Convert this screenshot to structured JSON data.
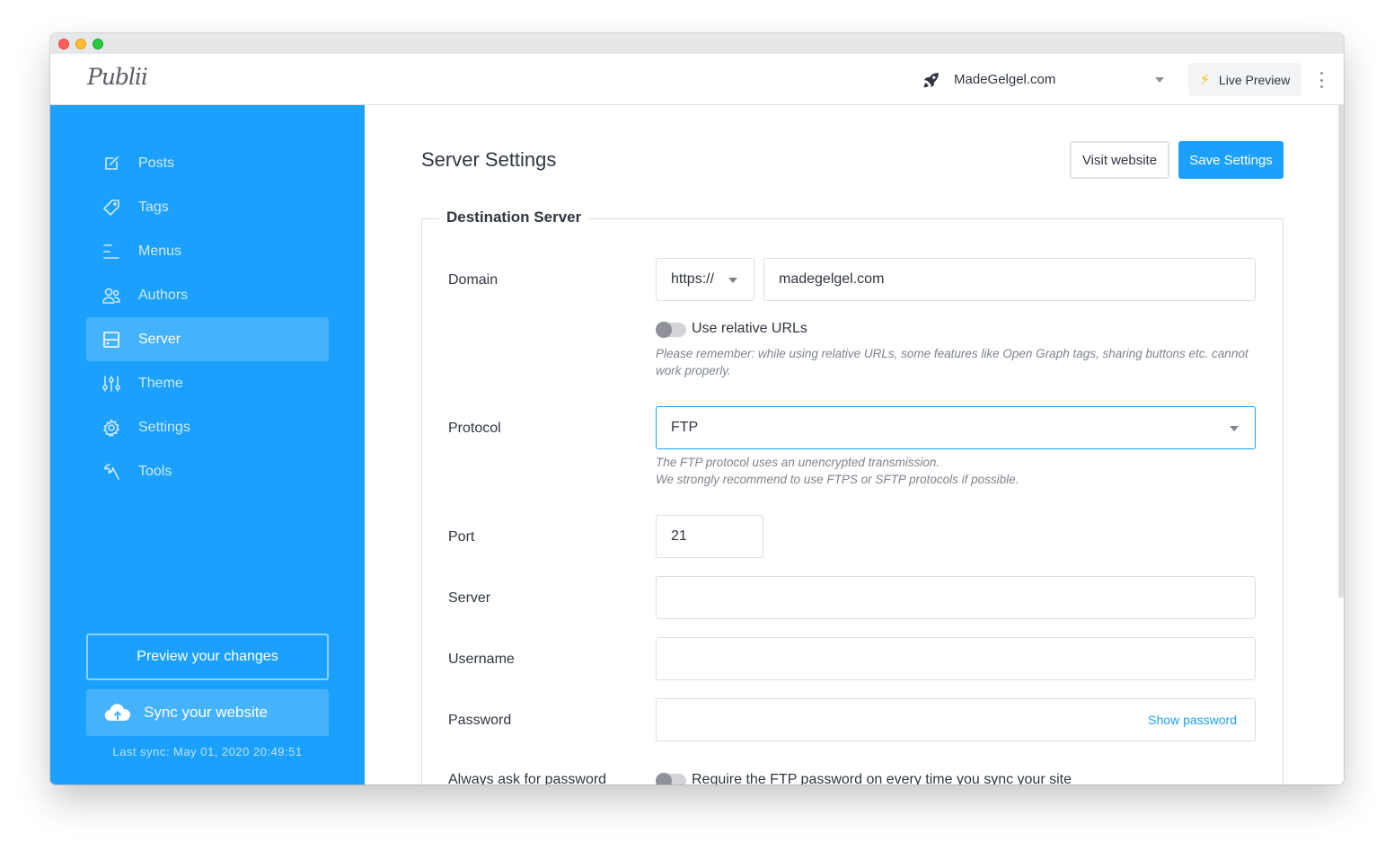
{
  "window": {
    "app_logo": "Publii"
  },
  "topbar": {
    "site_name": "MadeGelgel.com",
    "site_icon": "rocket-icon",
    "live_preview_label": "Live Preview",
    "live_preview_icon": "lightning-icon",
    "more_icon": "kebab-menu-icon"
  },
  "sidebar": {
    "items": [
      {
        "label": "Posts",
        "icon": "edit-icon",
        "active": false
      },
      {
        "label": "Tags",
        "icon": "tag-icon",
        "active": false
      },
      {
        "label": "Menus",
        "icon": "menu-icon",
        "active": false
      },
      {
        "label": "Authors",
        "icon": "users-icon",
        "active": false
      },
      {
        "label": "Server",
        "icon": "server-icon",
        "active": true
      },
      {
        "label": "Theme",
        "icon": "sliders-icon",
        "active": false
      },
      {
        "label": "Settings",
        "icon": "gear-icon",
        "active": false
      },
      {
        "label": "Tools",
        "icon": "wrench-icon",
        "active": false
      }
    ],
    "preview_button": "Preview your changes",
    "sync_button": "Sync your website",
    "sync_icon": "cloud-upload-icon",
    "last_sync": "Last sync: May 01, 2020 20:49:51"
  },
  "main": {
    "title": "Server Settings",
    "visit_button": "Visit website",
    "save_button": "Save Settings",
    "section_title": "Destination Server",
    "domain": {
      "label": "Domain",
      "protocol_prefix": "https://",
      "value": "madegelgel.com"
    },
    "relative_urls": {
      "label": "Use relative URLs",
      "enabled": false,
      "note": "Please remember: while using relative URLs, some features like Open Graph tags, sharing buttons etc. cannot work properly."
    },
    "protocol": {
      "label": "Protocol",
      "value": "FTP",
      "note_line1": "The FTP protocol uses an unencrypted transmission.",
      "note_line2": "We strongly recommend to use FTPS or SFTP protocols if possible."
    },
    "port": {
      "label": "Port",
      "value": "21"
    },
    "server": {
      "label": "Server",
      "value": ""
    },
    "username": {
      "label": "Username",
      "value": ""
    },
    "password": {
      "label": "Password",
      "value": "",
      "show_label": "Show password"
    },
    "always_ask": {
      "label": "Always ask for password",
      "toggle_label": "Require the FTP password on every time you sync your site",
      "enabled": false
    }
  },
  "colors": {
    "accent": "#1ba1fd",
    "sidebar_active": "#45b2fd",
    "live_preview_bolt": "#f6b910"
  }
}
